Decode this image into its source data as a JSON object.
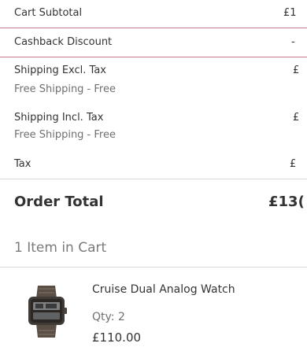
{
  "summary": {
    "cart_subtotal_label": "Cart Subtotal",
    "cart_subtotal_amount": "£1",
    "cashback_label": "Cashback Discount",
    "cashback_amount": "-",
    "shipping_excl_label": "Shipping Excl. Tax",
    "shipping_excl_method": "Free Shipping - Free",
    "shipping_excl_amount": "£",
    "shipping_incl_label": "Shipping Incl. Tax",
    "shipping_incl_method": "Free Shipping - Free",
    "shipping_incl_amount": "£",
    "tax_label": "Tax",
    "tax_amount": "£",
    "order_total_label": "Order Total",
    "order_total_amount": "£13("
  },
  "cart": {
    "items_in_cart": "1 Item in Cart",
    "items": [
      {
        "name": "Cruise Dual Analog Watch",
        "qty_label": "Qty:",
        "qty_value": "2",
        "price": "£110.00",
        "image_icon": "watch-icon"
      }
    ]
  },
  "colors": {
    "highlight_border": "#c8768a",
    "divider": "#d9d9d9",
    "text_primary": "#333333",
    "text_secondary": "#707070"
  }
}
